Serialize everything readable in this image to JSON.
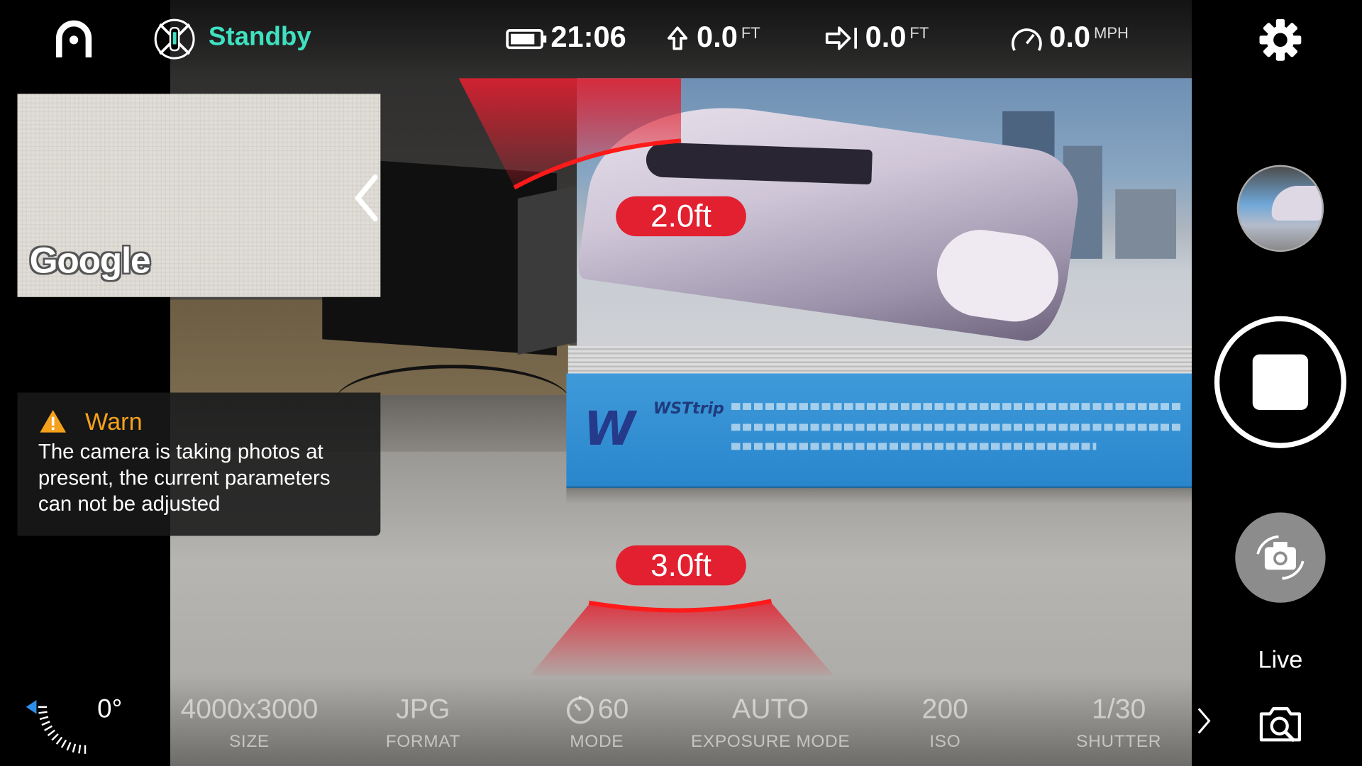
{
  "header": {
    "flight_status": "Standby",
    "time": "21:06",
    "altitude": {
      "value": "0.0",
      "unit": "FT"
    },
    "distance": {
      "value": "0.0",
      "unit": "FT"
    },
    "speed": {
      "value": "0.0",
      "unit": "MPH"
    },
    "battery_level": 0.85
  },
  "map": {
    "brand": "Google"
  },
  "warning": {
    "title": "Warn",
    "message": "The camera is taking photos at present, the current parameters can not be adjusted"
  },
  "obstacle": {
    "front_distance": "2.0ft",
    "rear_distance": "3.0ft"
  },
  "camera_params": [
    {
      "value": "4000x3000",
      "label": "SIZE"
    },
    {
      "value": "JPG",
      "label": "FORMAT"
    },
    {
      "value": "60",
      "label": "MODE",
      "icon": "timer-icon"
    },
    {
      "value": "AUTO",
      "label": "EXPOSURE MODE"
    },
    {
      "value": "200",
      "label": "ISO"
    },
    {
      "value": "1/30",
      "label": "SHUTTER"
    }
  ],
  "gimbal": {
    "pitch": "0°"
  },
  "right_panel": {
    "live_label": "Live"
  },
  "colors": {
    "accent": "#3fe1c1",
    "warning": "#f5a11c",
    "obstacle": "#e22030"
  }
}
